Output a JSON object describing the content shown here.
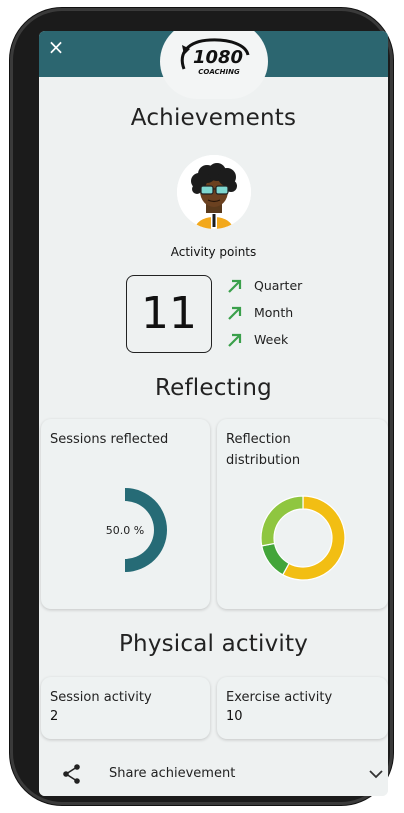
{
  "header": {
    "close_label": "×",
    "logo_line1": "1080",
    "logo_line2": "COACHING"
  },
  "achievements": {
    "title": "Achievements",
    "activity_points_label": "Activity points",
    "activity_points_value": "11",
    "trends": [
      {
        "label": "Quarter",
        "icon": "arrow-up-right-icon",
        "color": "#3aa04b"
      },
      {
        "label": "Month",
        "icon": "arrow-up-right-icon",
        "color": "#3aa04b"
      },
      {
        "label": "Week",
        "icon": "arrow-up-right-icon",
        "color": "#3aa04b"
      }
    ]
  },
  "reflecting": {
    "title": "Reflecting",
    "sessions_reflected": {
      "title": "Sessions reflected",
      "percent_label": "50.0 %",
      "percent_value": 50.0,
      "color": "#266b76"
    },
    "reflection_distribution": {
      "title_line1": "Reflection",
      "title_line2": "distribution",
      "segments": [
        {
          "share": 0.58,
          "color": "#f2be13"
        },
        {
          "share": 0.14,
          "color": "#43a53a"
        },
        {
          "share": 0.28,
          "color": "#8fc640"
        }
      ]
    }
  },
  "physical_activity": {
    "title": "Physical activity",
    "session_activity": {
      "title": "Session activity",
      "value": "2"
    },
    "exercise_activity": {
      "title": "Exercise activity",
      "value": "10"
    }
  },
  "footer": {
    "share_label": "Share achievement"
  },
  "colors": {
    "topbar": "#2c6670",
    "background": "#eef1f1",
    "trend_green": "#3aa04b"
  }
}
